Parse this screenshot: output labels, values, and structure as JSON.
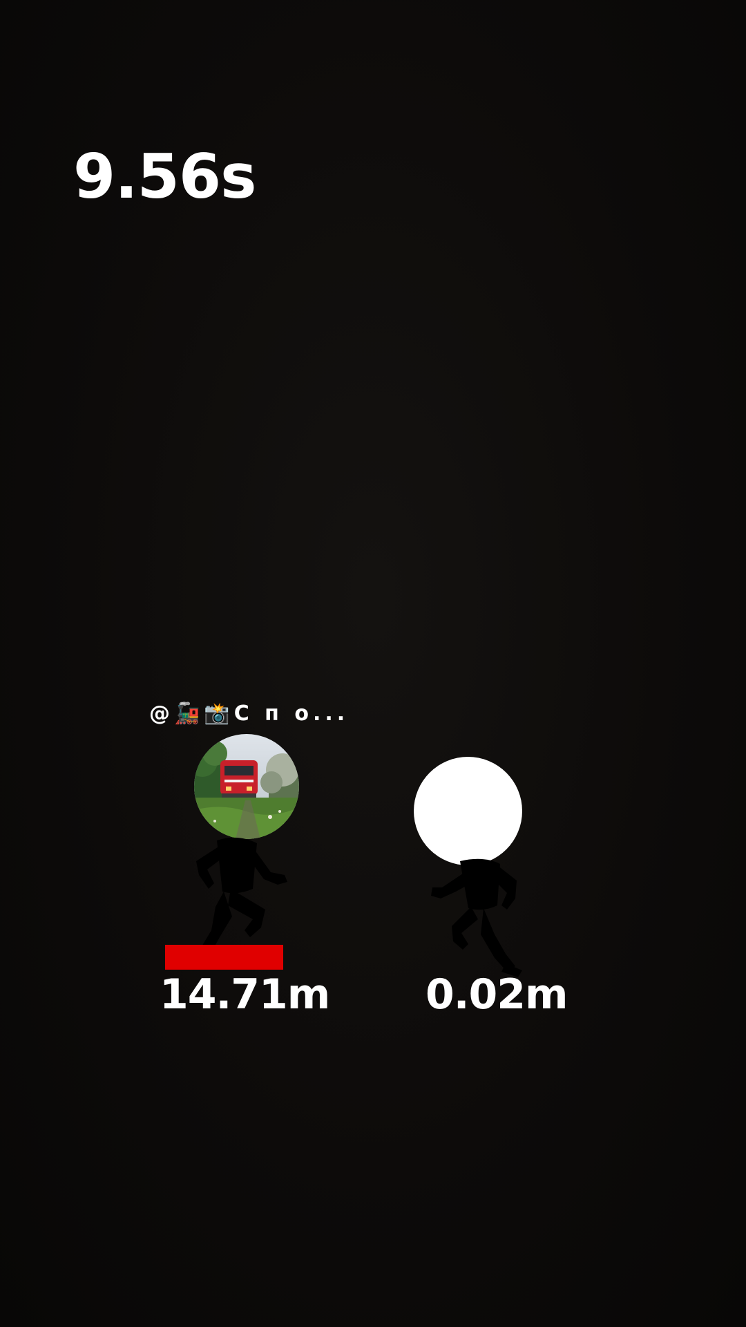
{
  "timer": {
    "value": "9.56s"
  },
  "players": [
    {
      "tag": "@🚂📸С п о...",
      "distance": "14.71m",
      "avatar": "train-photo",
      "has_marker": true
    },
    {
      "tag": "",
      "distance": "0.02m",
      "avatar": "blank-white-circle",
      "has_marker": false
    }
  ],
  "colors": {
    "background": "#0c0a09",
    "text": "#ffffff",
    "marker": "#e00000"
  }
}
